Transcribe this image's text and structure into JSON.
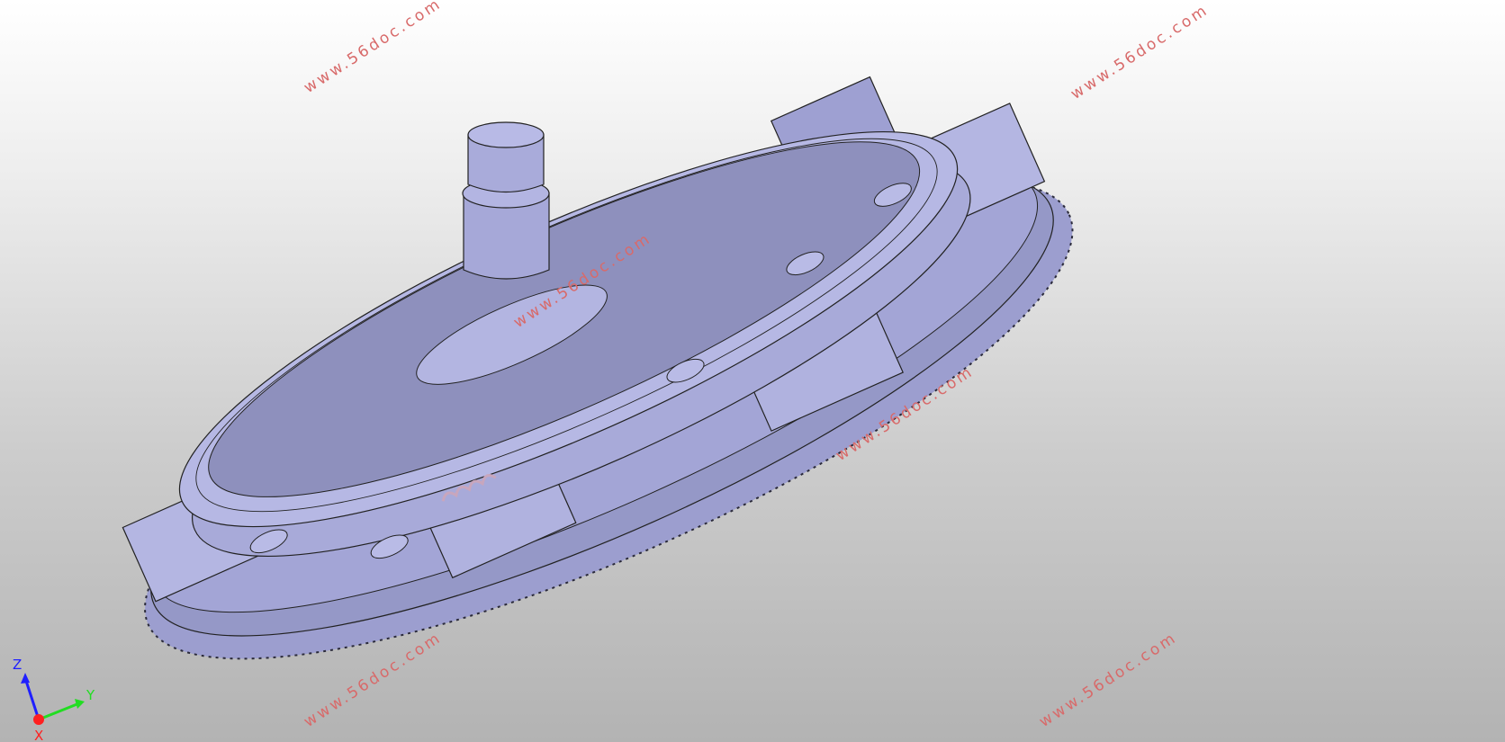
{
  "viewer": {
    "watermark_text": "www.56doc.com",
    "model_color": "#a4a6d6",
    "spring_color": "#c8a6bd"
  },
  "triad": {
    "x_label": "X",
    "y_label": "Y",
    "z_label": "Z",
    "x_color": "#ff2020",
    "y_color": "#22dd22",
    "z_color": "#2020ff"
  }
}
